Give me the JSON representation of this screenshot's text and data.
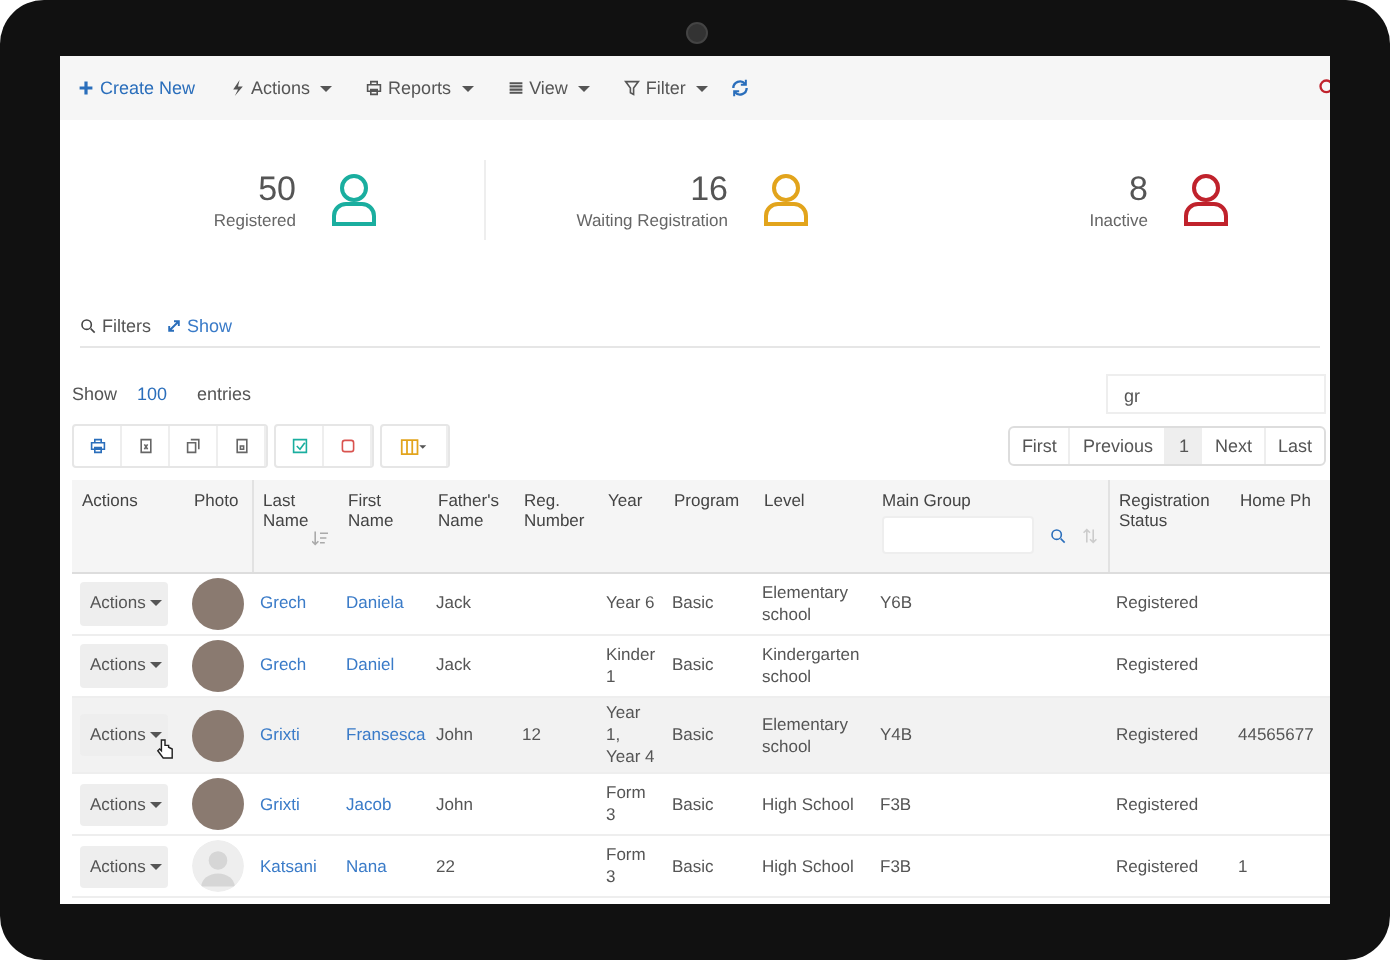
{
  "toolbar": [
    {
      "kind": "create",
      "label": "Create New"
    },
    {
      "kind": "actions",
      "label": "Actions"
    },
    {
      "kind": "reports",
      "label": "Reports"
    },
    {
      "kind": "view",
      "label": "View"
    },
    {
      "kind": "filter",
      "label": "Filter"
    }
  ],
  "stats": [
    {
      "value": "50",
      "label": "Registered",
      "color": "#1aae9f"
    },
    {
      "value": "16",
      "label": "Waiting Registration",
      "color": "#e2a41c"
    },
    {
      "value": "8",
      "label": "Inactive",
      "color": "#c0222c"
    }
  ],
  "filters": {
    "label": "Filters",
    "toggle": "Show"
  },
  "entries": {
    "prefix": "Show",
    "value": "100",
    "suffix": "entries"
  },
  "search": {
    "value": "gr"
  },
  "pagination": [
    {
      "label": "First",
      "selected": false
    },
    {
      "label": "Previous",
      "selected": false
    },
    {
      "label": "1",
      "selected": true
    },
    {
      "label": "Next",
      "selected": false
    },
    {
      "label": "Last",
      "selected": false
    }
  ],
  "columns": [
    "Actions",
    "Photo",
    "Last Name",
    "First Name",
    "Father's Name",
    "Reg. Number",
    "Year",
    "Program",
    "Level",
    "Main Group",
    "Registration Status",
    "Home Ph"
  ],
  "rows": [
    {
      "action": "Actions",
      "kind": "photo",
      "last": "Grech",
      "first": "Daniela",
      "father": "Jack",
      "reg": "",
      "year": "Year 6",
      "program": "Basic",
      "level": "Elementary school",
      "group": "Y6B",
      "status": "Registered",
      "phone": "",
      "hovered": false
    },
    {
      "action": "Actions",
      "kind": "photo",
      "last": "Grech",
      "first": "Daniel",
      "father": "Jack",
      "reg": "",
      "year": "Kinder 1",
      "program": "Basic",
      "level": "Kindergarten school",
      "group": "",
      "status": "Registered",
      "phone": "",
      "hovered": false
    },
    {
      "action": "Actions",
      "kind": "photo",
      "last": "Grixti",
      "first": "Fransesca",
      "father": "John",
      "reg": "12",
      "year": "Year 1, Year 4",
      "program": "Basic",
      "level": "Elementary school",
      "group": "Y4B",
      "status": "Registered",
      "phone": "44565677",
      "hovered": true
    },
    {
      "action": "Actions",
      "kind": "photo",
      "last": "Grixti",
      "first": "Jacob",
      "father": "John",
      "reg": "",
      "year": "Form 3",
      "program": "Basic",
      "level": "High School",
      "group": "F3B",
      "status": "Registered",
      "phone": "",
      "hovered": false
    },
    {
      "action": "Actions",
      "kind": "silhouette",
      "last": "Katsani",
      "first": "Nana",
      "father": "22",
      "reg": "",
      "year": "Form 3",
      "program": "Basic",
      "level": "High School",
      "group": "F3B",
      "status": "Registered",
      "phone": "1",
      "hovered": false
    }
  ]
}
